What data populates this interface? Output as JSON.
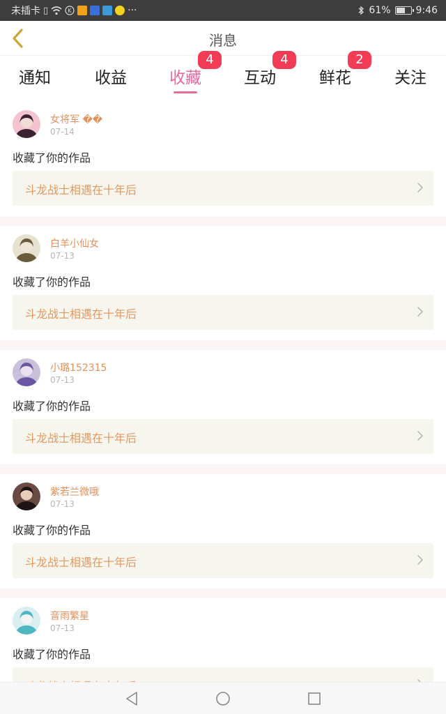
{
  "status_bar": {
    "carrier": "未插卡",
    "battery_text": "61%",
    "battery_level": 0.61,
    "time": "9:46",
    "more": "···"
  },
  "header": {
    "title": "消息"
  },
  "tabs": [
    {
      "label": "通知",
      "badge": ""
    },
    {
      "label": "收益",
      "badge": ""
    },
    {
      "label": "收藏",
      "badge": "4",
      "active": true
    },
    {
      "label": "互动",
      "badge": "4"
    },
    {
      "label": "鲜花",
      "badge": "2"
    },
    {
      "label": "关注",
      "badge": ""
    }
  ],
  "items": [
    {
      "user": "女将军 ��",
      "date": "07-14",
      "action": "收藏了你的作品",
      "work": "斗龙战士相遇在十年后"
    },
    {
      "user": "白羊小仙女",
      "date": "07-13",
      "action": "收藏了你的作品",
      "work": "斗龙战士相遇在十年后"
    },
    {
      "user": "小璐152315",
      "date": "07-13",
      "action": "收藏了你的作品",
      "work": "斗龙战士相遇在十年后"
    },
    {
      "user": "紫若兰微哦",
      "date": "07-13",
      "action": "收藏了你的作品",
      "work": "斗龙战士相遇在十年后"
    },
    {
      "user": "音雨繁星",
      "date": "07-13",
      "action": "收藏了你的作品",
      "work": "斗龙战士相遇在十年后"
    }
  ],
  "icons": {
    "back": "chevron-left-icon",
    "work_arrow": "chevron-right-icon",
    "nav_back": "triangle-back-icon",
    "nav_home": "circle-home-icon",
    "nav_recent": "square-recent-icon"
  },
  "colors": {
    "accent": "#e56b9f",
    "badge": "#f23b55",
    "username": "#e3905a",
    "work_title": "#e39a62",
    "work_bg": "#f6f5ee",
    "status_bar": "#3d3d3d"
  }
}
